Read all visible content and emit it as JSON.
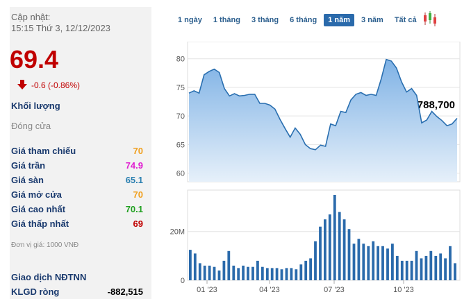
{
  "update": {
    "label": "Cập nhật:",
    "time": "15:15 Thứ 3, 12/12/2023"
  },
  "price": "69.4",
  "change": "-0.6 (-0.86%)",
  "volume": {
    "label": "Khối lượng",
    "value": "2,788,700"
  },
  "close_label": "Đóng cửa",
  "stats": [
    {
      "label": "Giá tham chiếu",
      "value": "70",
      "color": "#f0a020"
    },
    {
      "label": "Giá trần",
      "value": "74.9",
      "color": "#e020d0"
    },
    {
      "label": "Giá sàn",
      "value": "65.1",
      "color": "#2a7fb0"
    },
    {
      "label": "Giá mở cửa",
      "value": "70",
      "color": "#f0a020"
    },
    {
      "label": "Giá cao nhất",
      "value": "70.1",
      "color": "#20a020"
    },
    {
      "label": "Giá thấp nhất",
      "value": "69",
      "color": "#c00000"
    }
  ],
  "unit_note": "Đơn vị giá: 1000 VNĐ",
  "foreign": {
    "title": "Giao dịch NĐTNN",
    "net_label": "KLGD ròng",
    "net_value": "-882,515"
  },
  "tabs": [
    "1 ngày",
    "1 tháng",
    "3 tháng",
    "6 tháng",
    "1 năm",
    "3 năm",
    "Tất cả"
  ],
  "active_tab": "1 năm",
  "chart_data": {
    "type": "area",
    "price_axis": {
      "ticks": [
        "80",
        "75",
        "70",
        "65",
        "60"
      ],
      "ylim": [
        58.5,
        83
      ]
    },
    "volume_axis": {
      "ticks": [
        "20M",
        "0"
      ],
      "ylim": [
        0,
        37
      ]
    },
    "x_ticks": [
      "01 '23",
      "04 '23",
      "07 '23",
      "10 '23"
    ],
    "price": [
      74.0,
      74.4,
      74.0,
      77.2,
      77.8,
      78.2,
      77.6,
      74.8,
      73.5,
      73.9,
      73.5,
      73.6,
      73.8,
      73.8,
      72.2,
      72.2,
      71.9,
      71.2,
      69.4,
      67.8,
      66.3,
      67.9,
      66.8,
      65.0,
      64.3,
      64.1,
      64.9,
      64.7,
      68.6,
      68.3,
      70.8,
      70.6,
      72.8,
      73.8,
      74.1,
      73.6,
      73.8,
      73.6,
      76.5,
      79.9,
      79.6,
      78.4,
      76.0,
      74.2,
      74.8,
      73.6,
      68.8,
      69.3,
      70.8,
      69.9,
      69.2,
      68.3,
      68.6,
      69.6
    ],
    "volume": [
      12.5,
      11,
      7,
      6,
      6,
      5.5,
      4,
      8,
      12,
      6,
      5,
      6,
      5.5,
      5.5,
      8,
      5.5,
      5,
      5,
      5,
      4.5,
      5,
      5,
      4.5,
      6.5,
      8,
      9,
      16,
      22,
      25,
      27,
      35,
      28,
      25,
      21,
      15,
      17,
      15,
      14,
      16,
      14,
      14,
      13,
      15,
      10,
      8,
      8,
      8,
      12,
      9,
      10,
      12,
      10,
      11,
      9,
      14,
      7
    ]
  }
}
